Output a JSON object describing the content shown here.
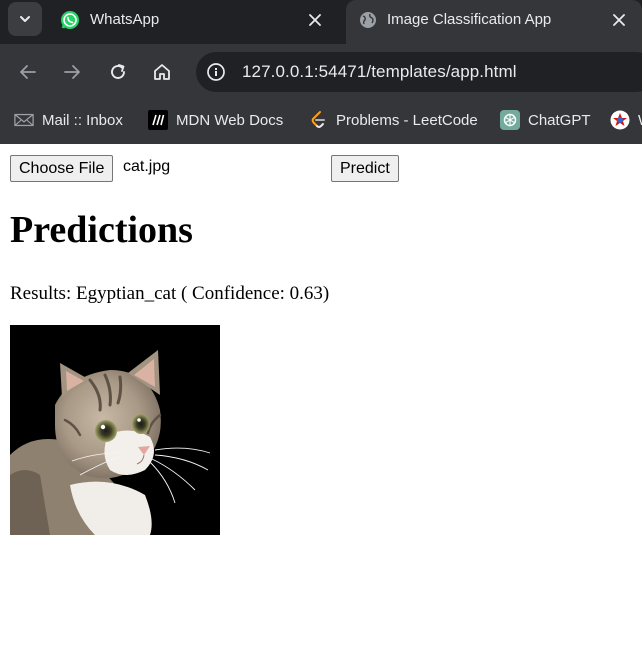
{
  "browser": {
    "tabs": [
      {
        "title": "WhatsApp",
        "icon": "whatsapp-icon",
        "active": false
      },
      {
        "title": "Image Classification App",
        "icon": "globe-icon",
        "active": true
      }
    ],
    "url": "127.0.0.1:54471/templates/app.html",
    "bookmarks": [
      {
        "label": "Mail :: Inbox",
        "icon": "mail-icon"
      },
      {
        "label": "MDN Web Docs",
        "icon": "mdn-icon"
      },
      {
        "label": "Problems - LeetCode",
        "icon": "leetcode-icon"
      },
      {
        "label": "ChatGPT",
        "icon": "chatgpt-icon"
      },
      {
        "label": "W",
        "icon": "wolfram-icon"
      }
    ]
  },
  "page": {
    "file_button_label": "Choose File",
    "file_name": "cat.jpg",
    "predict_button_label": "Predict",
    "heading": "Predictions",
    "results_text": "Results: Egyptian_cat ( Confidence: 0.63)"
  },
  "colors": {
    "tabstrip": "#202124",
    "toolbar": "#35363a",
    "whatsapp_green": "#25d366"
  }
}
